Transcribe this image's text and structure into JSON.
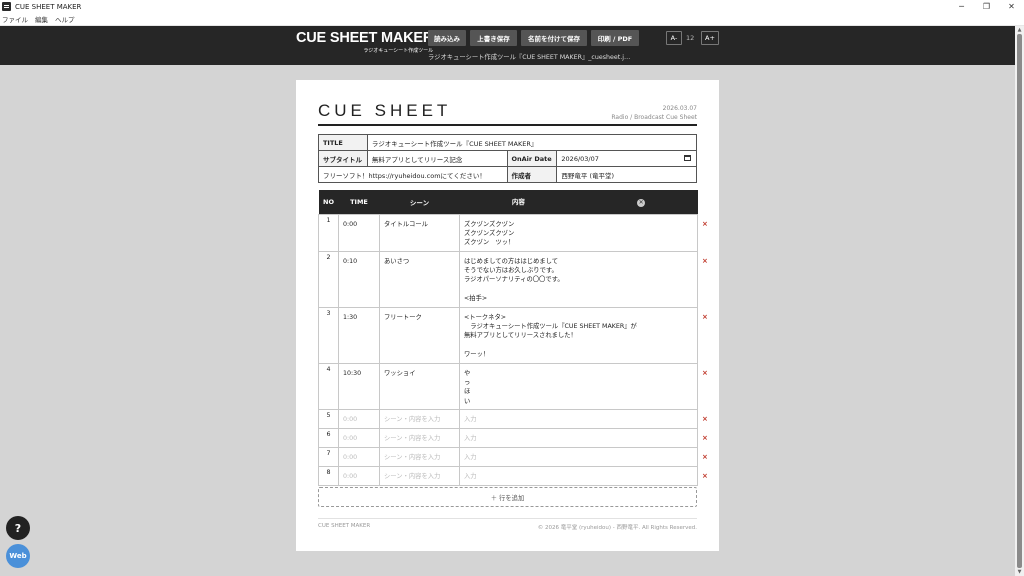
{
  "window": {
    "title": "CUE SHEET MAKER",
    "minimize": "─",
    "maximize": "❐",
    "close": "✕"
  },
  "menu": [
    "ファイル",
    "編集",
    "ヘルプ"
  ],
  "header": {
    "logo": "CUE SHEET MAKER",
    "logo_sub": "ラジオキューシート作成ツール",
    "buttons": [
      "読み込み",
      "上書き保存",
      "名前を付けて保存",
      "印刷 / PDF"
    ],
    "font_minus": "A-",
    "font_size": "12",
    "font_plus": "A+",
    "filename": "ラジオキューシート作成ツール『CUE SHEET MAKER』_cuesheet.j…"
  },
  "sheet": {
    "title": "CUE SHEET",
    "date": "2026.03.07",
    "subtitle_right": "Radio / Broadcast Cue Sheet",
    "meta": {
      "title_label": "TITLE",
      "title_value": "ラジオキューシート作成ツール『CUE SHEET MAKER』",
      "subtitle_label": "サブタイトル",
      "subtitle_value": "無料アプリとしてリリース記念",
      "onair_label": "OnAir Date",
      "onair_value": "2026/03/07",
      "note": "フリーソフト！https://ryuheidou.comにてください！",
      "author_label": "作成者",
      "author_value": "西野竜平 (竜平堂)"
    },
    "columns": [
      "NO",
      "TIME",
      "シーン",
      "内容"
    ],
    "clear_icon": "✕",
    "rows": [
      {
        "no": "1",
        "time": "0:00",
        "scene": "タイトルコール",
        "content": "ズクヅンズクヅン\nズクヅンズクヅン\nズクヅン　ツッ！"
      },
      {
        "no": "2",
        "time": "0:10",
        "scene": "あいさつ",
        "content": "はじめましての方ははじめまして\nそうでない方はお久しぶりです。\nラジオパーソナリティの〇〇です。\n\n<拍手>"
      },
      {
        "no": "3",
        "time": "1:30",
        "scene": "フリートーク",
        "content": "<トークネタ>\n　ラジオキューシート作成ツール『CUE SHEET MAKER』が\n無料アプリとしてリリースされました！\n\nワーッ！"
      },
      {
        "no": "4",
        "time": "10:30",
        "scene": "ワッショイ",
        "content": "や\nっ\nほ\nい"
      },
      {
        "no": "5",
        "time": "0:00",
        "scene": "シーン・内容を入力",
        "content": "入力"
      },
      {
        "no": "6",
        "time": "0:00",
        "scene": "シーン・内容を入力",
        "content": "入力"
      },
      {
        "no": "7",
        "time": "0:00",
        "scene": "シーン・内容を入力",
        "content": "入力"
      },
      {
        "no": "8",
        "time": "0:00",
        "scene": "シーン・内容を入力",
        "content": "入力"
      }
    ],
    "delete_icon": "×",
    "add_row": "＋ 行を追加",
    "footer_left": "CUE SHEET MAKER",
    "footer_right": "© 2026 竜平堂 (ryuheidou) - 西野竜平. All Rights Reserved."
  },
  "floating": {
    "help": "?",
    "web": "Web"
  }
}
